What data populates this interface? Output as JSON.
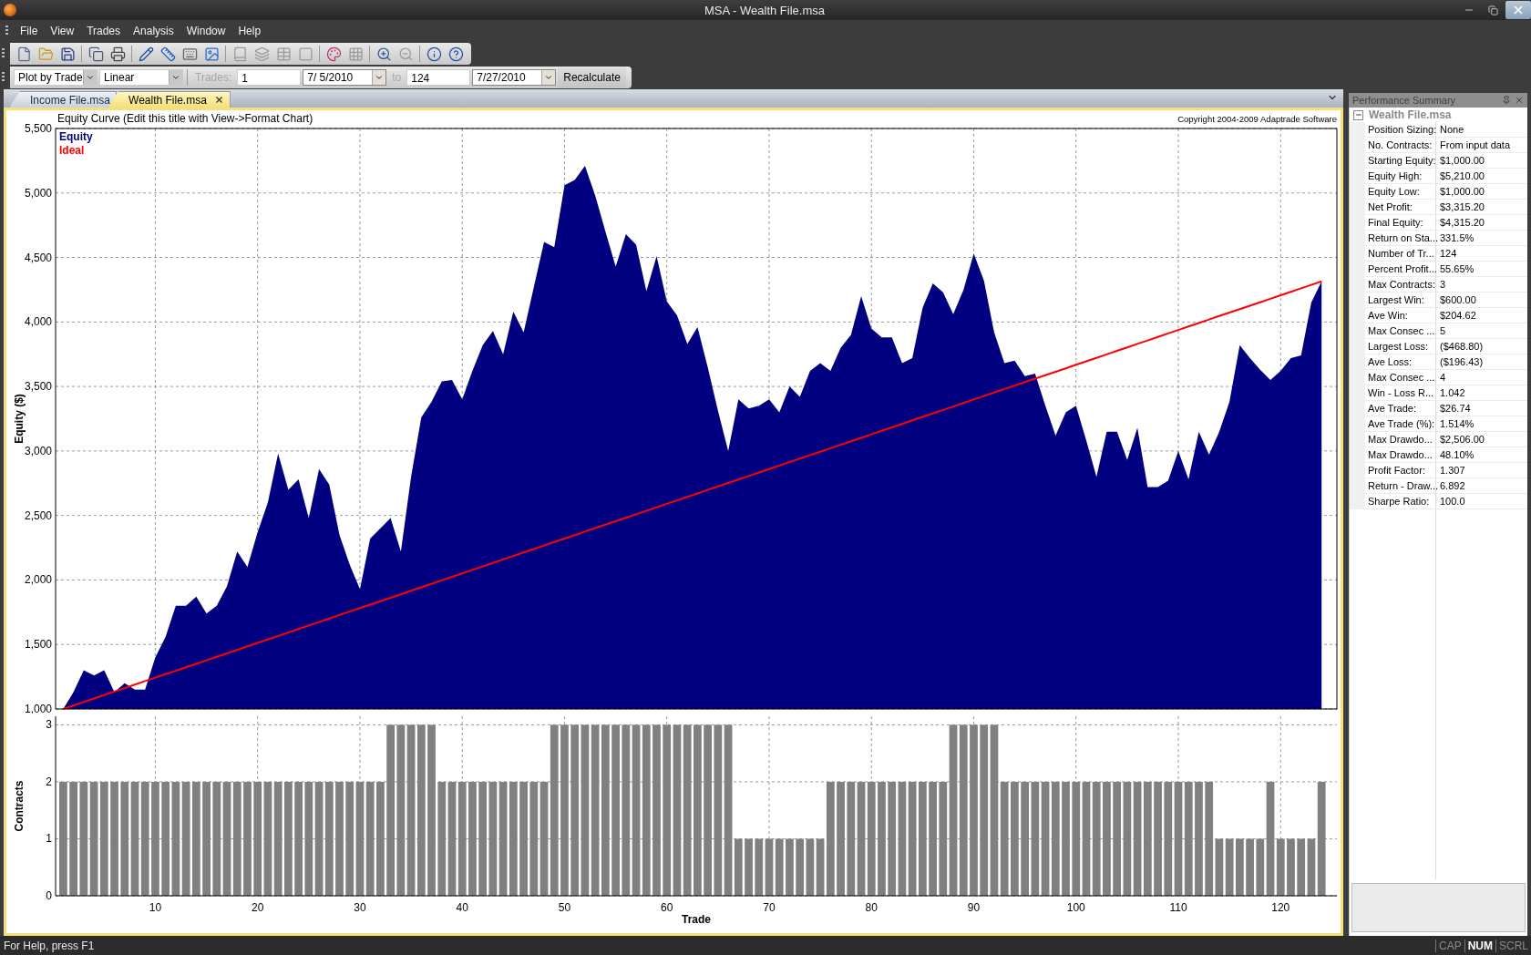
{
  "window": {
    "title": "MSA - Wealth File.msa"
  },
  "menu": [
    "File",
    "View",
    "Trades",
    "Analysis",
    "Window",
    "Help"
  ],
  "toolbar": [
    {
      "kind": "new",
      "disabled": false
    },
    {
      "kind": "open",
      "disabled": false
    },
    {
      "kind": "save",
      "disabled": false
    },
    {
      "kind": "separator"
    },
    {
      "kind": "copy",
      "disabled": false
    },
    {
      "kind": "print",
      "disabled": false
    },
    {
      "kind": "separator"
    },
    {
      "kind": "edit",
      "disabled": false
    },
    {
      "kind": "format",
      "disabled": false
    },
    {
      "kind": "keyboard",
      "disabled": false
    },
    {
      "kind": "picture",
      "disabled": false
    },
    {
      "kind": "separator"
    },
    {
      "kind": "chart_a",
      "disabled": true
    },
    {
      "kind": "chart_b",
      "disabled": true
    },
    {
      "kind": "chart_c",
      "disabled": true
    },
    {
      "kind": "chart_d",
      "disabled": true
    },
    {
      "kind": "separator"
    },
    {
      "kind": "colors",
      "disabled": false
    },
    {
      "kind": "grid",
      "disabled": true
    },
    {
      "kind": "separator"
    },
    {
      "kind": "zoom_in",
      "disabled": false
    },
    {
      "kind": "zoom_out",
      "disabled": true
    },
    {
      "kind": "separator"
    },
    {
      "kind": "info",
      "disabled": false
    },
    {
      "kind": "help",
      "disabled": false
    }
  ],
  "chart_toolbar": {
    "plot_mode": "Plot by Trade",
    "scale": "Linear",
    "trades_label": "Trades:",
    "from_trade": "1",
    "from_date": "7/ 5/2010",
    "to_label": "to",
    "to_trade": "124",
    "to_date": "7/27/2010",
    "recalculate": "Recalculate"
  },
  "tabs": [
    {
      "label": "Income File.msa",
      "selected": false
    },
    {
      "label": "Wealth File.msa",
      "selected": true
    }
  ],
  "equity_chart": {
    "copyright": "Copyright 2004-2009 Adaptrade Software",
    "chart_data": {
      "type": "area",
      "title": "Equity Curve (Edit this title with View->Format Chart)",
      "ylabel": "Equity ($)",
      "xlim": [
        0.25,
        125.5
      ],
      "ylim": [
        1000,
        5500
      ],
      "grid": true,
      "yticks": [
        {
          "value": 1000,
          "label": "1,000"
        },
        {
          "value": 1500,
          "label": "1,500"
        },
        {
          "value": 2000,
          "label": "2,000"
        },
        {
          "value": 2500,
          "label": "2,500"
        },
        {
          "value": 3000,
          "label": "3,000"
        },
        {
          "value": 3500,
          "label": "3,500"
        },
        {
          "value": 4000,
          "label": "4,000"
        },
        {
          "value": 4500,
          "label": "4,500"
        },
        {
          "value": 5000,
          "label": "5,000"
        },
        {
          "value": 5500,
          "label": "5,500"
        }
      ],
      "x": [
        1,
        2,
        3,
        4,
        5,
        6,
        7,
        8,
        9,
        10,
        11,
        12,
        13,
        14,
        15,
        16,
        17,
        18,
        19,
        20,
        21,
        22,
        23,
        24,
        25,
        26,
        27,
        28,
        29,
        30,
        31,
        32,
        33,
        34,
        35,
        36,
        37,
        38,
        39,
        40,
        41,
        42,
        43,
        44,
        45,
        46,
        47,
        48,
        49,
        50,
        51,
        52,
        53,
        54,
        55,
        56,
        57,
        58,
        59,
        60,
        61,
        62,
        63,
        64,
        65,
        66,
        67,
        68,
        69,
        70,
        71,
        72,
        73,
        74,
        75,
        76,
        77,
        78,
        79,
        80,
        81,
        82,
        83,
        84,
        85,
        86,
        87,
        88,
        89,
        90,
        91,
        92,
        93,
        94,
        95,
        96,
        97,
        98,
        99,
        100,
        101,
        102,
        103,
        104,
        105,
        106,
        107,
        108,
        109,
        110,
        111,
        112,
        113,
        114,
        115,
        116,
        117,
        118,
        119,
        120,
        121,
        122,
        123,
        124
      ],
      "series": [
        {
          "name": "Equity",
          "type": "area",
          "color": "#000080",
          "values": [
            1000,
            1130,
            1300,
            1260,
            1300,
            1130,
            1200,
            1150,
            1150,
            1400,
            1560,
            1800,
            1800,
            1870,
            1740,
            1800,
            1950,
            2220,
            2100,
            2370,
            2600,
            2980,
            2700,
            2780,
            2480,
            2860,
            2740,
            2350,
            2120,
            1930,
            2320,
            2400,
            2480,
            2220,
            2800,
            3260,
            3380,
            3540,
            3550,
            3400,
            3620,
            3820,
            3930,
            3750,
            4080,
            3920,
            4270,
            4620,
            4580,
            5060,
            5100,
            5210,
            4980,
            4700,
            4430,
            4680,
            4600,
            4240,
            4510,
            4160,
            4050,
            3830,
            3960,
            3650,
            3310,
            3000,
            3400,
            3330,
            3350,
            3400,
            3300,
            3500,
            3420,
            3620,
            3680,
            3620,
            3800,
            3900,
            4200,
            3950,
            3880,
            3880,
            3680,
            3720,
            4110,
            4300,
            4230,
            4060,
            4250,
            4530,
            4320,
            3920,
            3680,
            3700,
            3580,
            3600,
            3350,
            3120,
            3300,
            3350,
            3080,
            2800,
            3150,
            3150,
            2930,
            3180,
            2720,
            2720,
            2770,
            3000,
            2780,
            3150,
            2970,
            3150,
            3380,
            3820,
            3720,
            3630,
            3550,
            3620,
            3720,
            3740,
            4150,
            4315
          ]
        },
        {
          "name": "Ideal",
          "type": "line",
          "color": "#ff0000",
          "values": [
            1000,
            1027,
            1054,
            1081,
            1108,
            1135,
            1162,
            1189,
            1216,
            1243,
            1270,
            1296,
            1323,
            1350,
            1377,
            1404,
            1431,
            1458,
            1485,
            1512,
            1539,
            1566,
            1593,
            1620,
            1647,
            1674,
            1701,
            1728,
            1755,
            1782,
            1809,
            1836,
            1862,
            1889,
            1916,
            1943,
            1970,
            1997,
            2024,
            2051,
            2078,
            2105,
            2132,
            2159,
            2186,
            2213,
            2240,
            2267,
            2294,
            2321,
            2348,
            2375,
            2402,
            2429,
            2455,
            2482,
            2509,
            2536,
            2563,
            2590,
            2617,
            2644,
            2671,
            2698,
            2725,
            2752,
            2779,
            2806,
            2833,
            2860,
            2887,
            2914,
            2941,
            2968,
            2994,
            3021,
            3048,
            3075,
            3102,
            3129,
            3156,
            3183,
            3210,
            3237,
            3264,
            3291,
            3318,
            3345,
            3372,
            3399,
            3426,
            3453,
            3480,
            3507,
            3534,
            3561,
            3587,
            3614,
            3641,
            3668,
            3695,
            3722,
            3749,
            3776,
            3803,
            3830,
            3857,
            3884,
            3911,
            3938,
            3965,
            3992,
            4019,
            4046,
            4073,
            4100,
            4126,
            4153,
            4180,
            4207,
            4234,
            4261,
            4288,
            4315
          ]
        }
      ]
    }
  },
  "contracts_chart": {
    "chart_data": {
      "type": "bar",
      "xlabel": "Trade",
      "ylabel": "Contracts",
      "xlim": [
        0.25,
        125.5
      ],
      "ylim": [
        0,
        3.15
      ],
      "grid": true,
      "xticks": [
        10,
        20,
        30,
        40,
        50,
        60,
        70,
        80,
        90,
        100,
        110,
        120
      ],
      "yticks": [
        0,
        1,
        2,
        3
      ],
      "x": [
        1,
        2,
        3,
        4,
        5,
        6,
        7,
        8,
        9,
        10,
        11,
        12,
        13,
        14,
        15,
        16,
        17,
        18,
        19,
        20,
        21,
        22,
        23,
        24,
        25,
        26,
        27,
        28,
        29,
        30,
        31,
        32,
        33,
        34,
        35,
        36,
        37,
        38,
        39,
        40,
        41,
        42,
        43,
        44,
        45,
        46,
        47,
        48,
        49,
        50,
        51,
        52,
        53,
        54,
        55,
        56,
        57,
        58,
        59,
        60,
        61,
        62,
        63,
        64,
        65,
        66,
        67,
        68,
        69,
        70,
        71,
        72,
        73,
        74,
        75,
        76,
        77,
        78,
        79,
        80,
        81,
        82,
        83,
        84,
        85,
        86,
        87,
        88,
        89,
        90,
        91,
        92,
        93,
        94,
        95,
        96,
        97,
        98,
        99,
        100,
        101,
        102,
        103,
        104,
        105,
        106,
        107,
        108,
        109,
        110,
        111,
        112,
        113,
        114,
        115,
        116,
        117,
        118,
        119,
        120,
        121,
        122,
        123,
        124
      ],
      "series": [
        {
          "color": "#808080",
          "values": [
            2,
            2,
            2,
            2,
            2,
            2,
            2,
            2,
            2,
            2,
            2,
            2,
            2,
            2,
            2,
            2,
            2,
            2,
            2,
            2,
            2,
            2,
            2,
            2,
            2,
            2,
            2,
            2,
            2,
            2,
            2,
            2,
            3,
            3,
            3,
            3,
            3,
            2,
            2,
            2,
            2,
            2,
            2,
            2,
            2,
            2,
            2,
            2,
            3,
            3,
            3,
            3,
            3,
            3,
            3,
            3,
            3,
            3,
            3,
            3,
            3,
            3,
            3,
            3,
            3,
            3,
            1,
            1,
            1,
            1,
            1,
            1,
            1,
            1,
            1,
            2,
            2,
            2,
            2,
            2,
            2,
            2,
            2,
            2,
            2,
            2,
            2,
            3,
            3,
            3,
            3,
            3,
            2,
            2,
            2,
            2,
            2,
            2,
            2,
            2,
            2,
            2,
            2,
            2,
            2,
            2,
            2,
            2,
            2,
            2,
            2,
            2,
            2,
            1,
            1,
            1,
            1,
            1,
            2,
            1,
            1,
            1,
            1,
            2
          ]
        }
      ]
    }
  },
  "performance_summary": {
    "title": "Performance Summary",
    "file": {
      "label": "Wealth File.msa",
      "expanded": true
    },
    "rows": [
      {
        "label": "Position Sizing:",
        "value": "None"
      },
      {
        "label": "No. Contracts:",
        "value": "From input data"
      },
      {
        "label": "Starting Equity:",
        "value": "$1,000.00"
      },
      {
        "label": "Equity High:",
        "value": "$5,210.00"
      },
      {
        "label": "Equity Low:",
        "value": "$1,000.00"
      },
      {
        "label": "Net Profit:",
        "value": "$3,315.20"
      },
      {
        "label": "Final Equity:",
        "value": "$4,315.20"
      },
      {
        "label": "Return on Sta...",
        "value": "331.5%"
      },
      {
        "label": "Number of Tr...",
        "value": "124"
      },
      {
        "label": "Percent Profit...",
        "value": "55.65%"
      },
      {
        "label": "Max Contracts:",
        "value": "3"
      },
      {
        "label": "Largest Win:",
        "value": "$600.00"
      },
      {
        "label": "Ave Win:",
        "value": "$204.62"
      },
      {
        "label": "Max Consec ...",
        "value": "5"
      },
      {
        "label": "Largest Loss:",
        "value": "($468.80)"
      },
      {
        "label": "Ave Loss:",
        "value": "($196.43)"
      },
      {
        "label": "Max Consec ...",
        "value": "4"
      },
      {
        "label": "Win - Loss R...",
        "value": "1.042"
      },
      {
        "label": "Ave Trade:",
        "value": "$26.74"
      },
      {
        "label": "Ave Trade (%):",
        "value": "1.514%"
      },
      {
        "label": "Max Drawdo...",
        "value": "$2,506.00"
      },
      {
        "label": "Max Drawdo...",
        "value": "48.10%"
      },
      {
        "label": "Profit Factor:",
        "value": "1.307"
      },
      {
        "label": "Return - Draw...",
        "value": "6.892"
      },
      {
        "label": "Sharpe Ratio:",
        "value": "100.0"
      }
    ]
  },
  "status_bar": {
    "message": "For Help, press F1",
    "indicators": [
      {
        "label": "CAP",
        "on": false
      },
      {
        "label": "NUM",
        "on": true
      },
      {
        "label": "SCRL",
        "on": false
      }
    ]
  }
}
